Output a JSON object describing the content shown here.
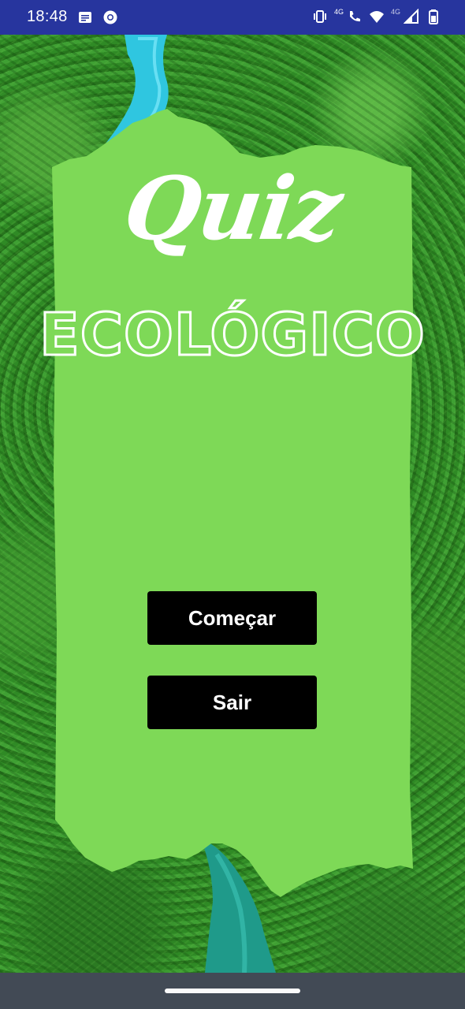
{
  "status_bar": {
    "time": "18:48",
    "left_icons": [
      "message-icon",
      "chrome-icon"
    ],
    "network_label_1": "4G",
    "network_label_2": "4G",
    "right_icons": [
      "vibrate-icon",
      "volte-call-icon",
      "wifi-icon",
      "signal-icon",
      "battery-icon"
    ]
  },
  "main": {
    "title_script": "Quiz",
    "title_main": "ECOLÓGICO",
    "buttons": {
      "start_label": "Começar",
      "exit_label": "Sair"
    }
  },
  "colors": {
    "status_bar": "#27359e",
    "paper_green": "#7ed957",
    "button_bg": "#000000",
    "button_text": "#ffffff",
    "nav_bar": "#424a55"
  }
}
